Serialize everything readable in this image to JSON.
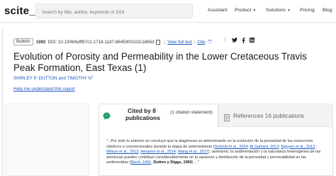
{
  "header": {
    "logo": "scite_",
    "search_placeholder": "Search by title, author, keywords or DOI",
    "nav": [
      {
        "label": "Assistant",
        "has_menu": false
      },
      {
        "label": "Product",
        "has_menu": true
      },
      {
        "label": "Solutions",
        "has_menu": true
      },
      {
        "label": "Pricing",
        "has_menu": false
      },
      {
        "label": "Blog",
        "has_menu": false
      }
    ]
  },
  "article": {
    "type_badge": "Bulletin",
    "year": "1992",
    "doi": "DOI: 10.1306/bdff87c2-1718-11d7-8645000102c1865d",
    "view_full_text": "View full text",
    "cite": "Cite",
    "title": "Evolution of Porosity and Permeability in the Lower Cretaceous Travis Peak Formation, East Texas (1)",
    "authors": "SHIRLEY P. DUTTON and TIMOTHY N",
    "author_sup": "1",
    "help_link": "Help me understand this report"
  },
  "tabs": {
    "cited_by": "Cited by 8 publications",
    "citation_statement": "(1 citation statement)",
    "references": "References 16 publications"
  },
  "citation_excerpt": {
    "open": "\"...",
    "text1": "Por todo lo anterior se concluye que la diagénesis es determinante en la evolución de la porosidad de los reservorios clásticos o convencionales durante la etapa de soterramiento (",
    "ref1": "Schmid et al., 2004",
    "sep1": "; ",
    "ref2": "Al Gahtani, 2013",
    "sep2": "; ",
    "ref3": "Nguyen et al., 2013",
    "sep3": "; ",
    "ref4": "Wilson et al., 2013",
    "sep4": "; ",
    "ref5": "Henares et al., 2014",
    "sep5": "; ",
    "ref6": "Wang et al., 2017",
    "text2": "), asimismo, la sedimentación y la naturaleza heterogénea de las areniscas pueden contribuir considerablemente en la variación y distribución de la porosidad y permeabilidad en las sedimentitas (",
    "ref7": "Bloch, 1991",
    "sep7": "; ",
    "ref8": "Dutton y Diggs, 1992",
    "close": ") ...\""
  },
  "colors": {
    "link": "#1a56c4",
    "cited_icon": "#22a06b",
    "twitter": "#1da1f2"
  }
}
